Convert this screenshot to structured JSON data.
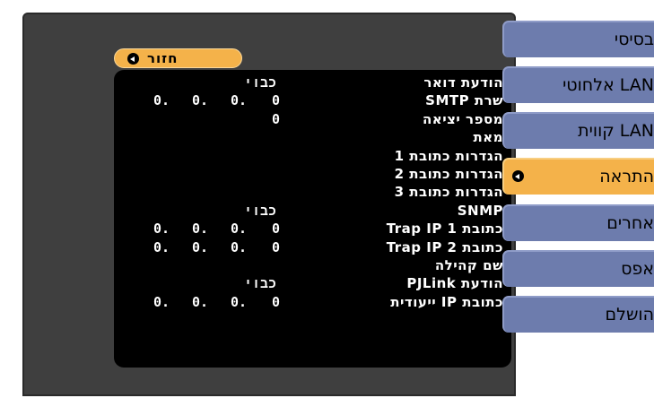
{
  "sidebar": {
    "items": [
      {
        "label": "בסיסי",
        "active": false
      },
      {
        "label": "LAN אלחוטי",
        "active": false
      },
      {
        "label": "LAN קווית",
        "active": false
      },
      {
        "label": "התראה",
        "active": true
      },
      {
        "label": "אחרים",
        "active": false
      },
      {
        "label": "אפס",
        "active": false
      },
      {
        "label": "הושלם",
        "active": false
      }
    ]
  },
  "back": {
    "label": "חזור"
  },
  "rows": [
    {
      "label": "הודעת דואר",
      "value": "כבוי"
    },
    {
      "label": "שרת SMTP",
      "ip": [
        "0.",
        "0.",
        "0.",
        "0"
      ]
    },
    {
      "label": "מספר יציאה",
      "value": "0"
    },
    {
      "label": "מאת"
    },
    {
      "label": "הגדרות כתובת 1"
    },
    {
      "label": "הגדרות כתובת 2"
    },
    {
      "label": "הגדרות כתובת 3"
    },
    {
      "label": "SNMP",
      "value": "כבוי"
    },
    {
      "label": "כתובת Trap IP 1",
      "ip": [
        "0.",
        "0.",
        "0.",
        "0"
      ]
    },
    {
      "label": "כתובת Trap IP 2",
      "ip": [
        "0.",
        "0.",
        "0.",
        "0"
      ]
    },
    {
      "label": "שם קהילה"
    },
    {
      "label": "הודעת PJLink",
      "value": "כבוי"
    },
    {
      "label": "כתובת IP ייעודית",
      "ip": [
        "0.",
        "0.",
        "0.",
        "0"
      ]
    }
  ]
}
